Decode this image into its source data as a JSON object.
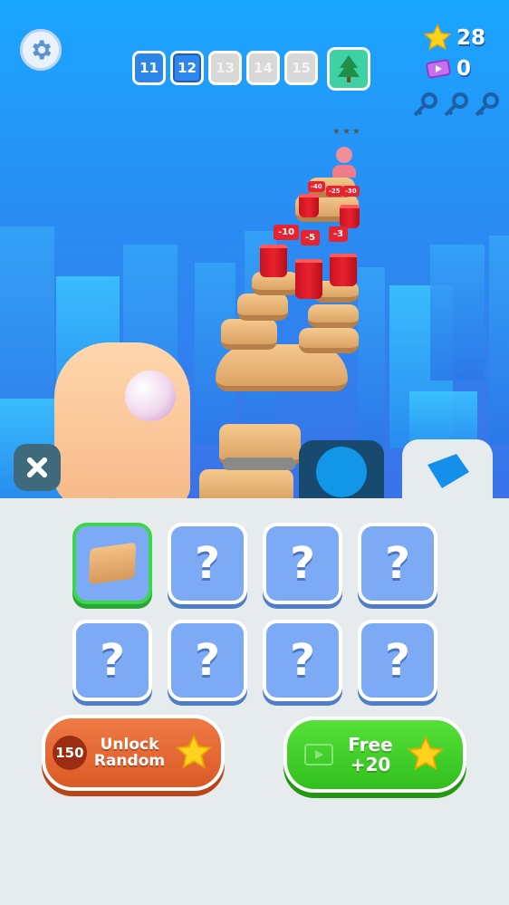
{
  "hud": {
    "levels": [
      {
        "label": "11",
        "state": "done"
      },
      {
        "label": "12",
        "state": "current"
      },
      {
        "label": "13",
        "state": "locked"
      },
      {
        "label": "14",
        "state": "locked"
      },
      {
        "label": "15",
        "state": "locked"
      }
    ],
    "reward_icon": "tree-icon",
    "stars": "28",
    "tickets": "0",
    "keys_count": 3
  },
  "scene": {
    "level_stars": "★★★",
    "minus_labels": [
      "-40",
      "-25",
      "-30",
      "-10",
      "-5",
      "-3"
    ]
  },
  "tabs": {
    "shapes_icon": "circle-icon",
    "skins_icon": "tile-icon"
  },
  "shop": {
    "slots": [
      {
        "state": "selected",
        "label": ""
      },
      {
        "state": "locked",
        "label": "?"
      },
      {
        "state": "locked",
        "label": "?"
      },
      {
        "state": "locked",
        "label": "?"
      },
      {
        "state": "locked",
        "label": "?"
      },
      {
        "state": "locked",
        "label": "?"
      },
      {
        "state": "locked",
        "label": "?"
      },
      {
        "state": "locked",
        "label": "?"
      }
    ],
    "unlock_cost": "150",
    "unlock_label_1": "Unlock",
    "unlock_label_2": "Random",
    "free_label_1": "Free",
    "free_label_2": "+20"
  },
  "colors": {
    "accent_green": "#3bd64a",
    "unlock_orange": "#e4642f",
    "free_green": "#3cc927",
    "slot_blue": "#7daaf4",
    "star_yellow": "#ffd21f"
  }
}
